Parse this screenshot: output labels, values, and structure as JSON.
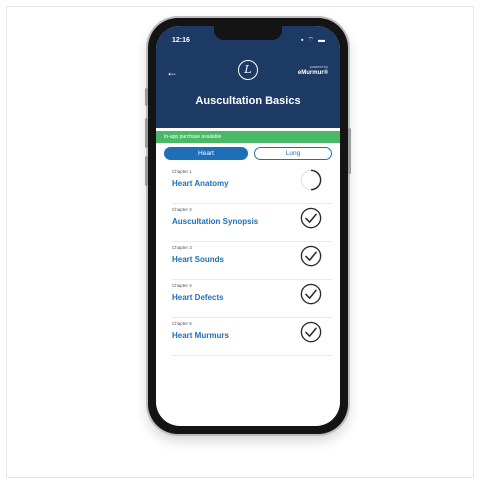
{
  "status_bar": {
    "time": "12:16",
    "icons": "▪ ⌔ ▬"
  },
  "header": {
    "back_glyph": "←",
    "logo_glyph": "L",
    "powered_by": "powered by",
    "brand": "eMurmur®",
    "title": "Auscultation Basics"
  },
  "banner": {
    "text": "In-app purchase available"
  },
  "tabs": [
    {
      "label": "Heart",
      "selected": true
    },
    {
      "label": "Lung",
      "selected": false
    }
  ],
  "chapters": [
    {
      "number": "Chapter 1",
      "title": "Heart Anatomy",
      "status": "in-progress"
    },
    {
      "number": "Chapter 2",
      "title": "Auscultation Synopsis",
      "status": "complete"
    },
    {
      "number": "Chapter 3",
      "title": "Heart Sounds",
      "status": "complete"
    },
    {
      "number": "Chapter 4",
      "title": "Heart Defects",
      "status": "complete"
    },
    {
      "number": "Chapter 5",
      "title": "Heart Murmurs",
      "status": "complete"
    }
  ],
  "colors": {
    "header_bg": "#1c3a63",
    "accent": "#1f6fb6",
    "banner_bg": "#4ab867",
    "check": "#2b2b2b"
  },
  "icons": {
    "back": "back-arrow-icon",
    "logo": "littmann-logo-icon",
    "complete": "checkmark-circle-icon",
    "in_progress": "progress-ring-icon"
  }
}
